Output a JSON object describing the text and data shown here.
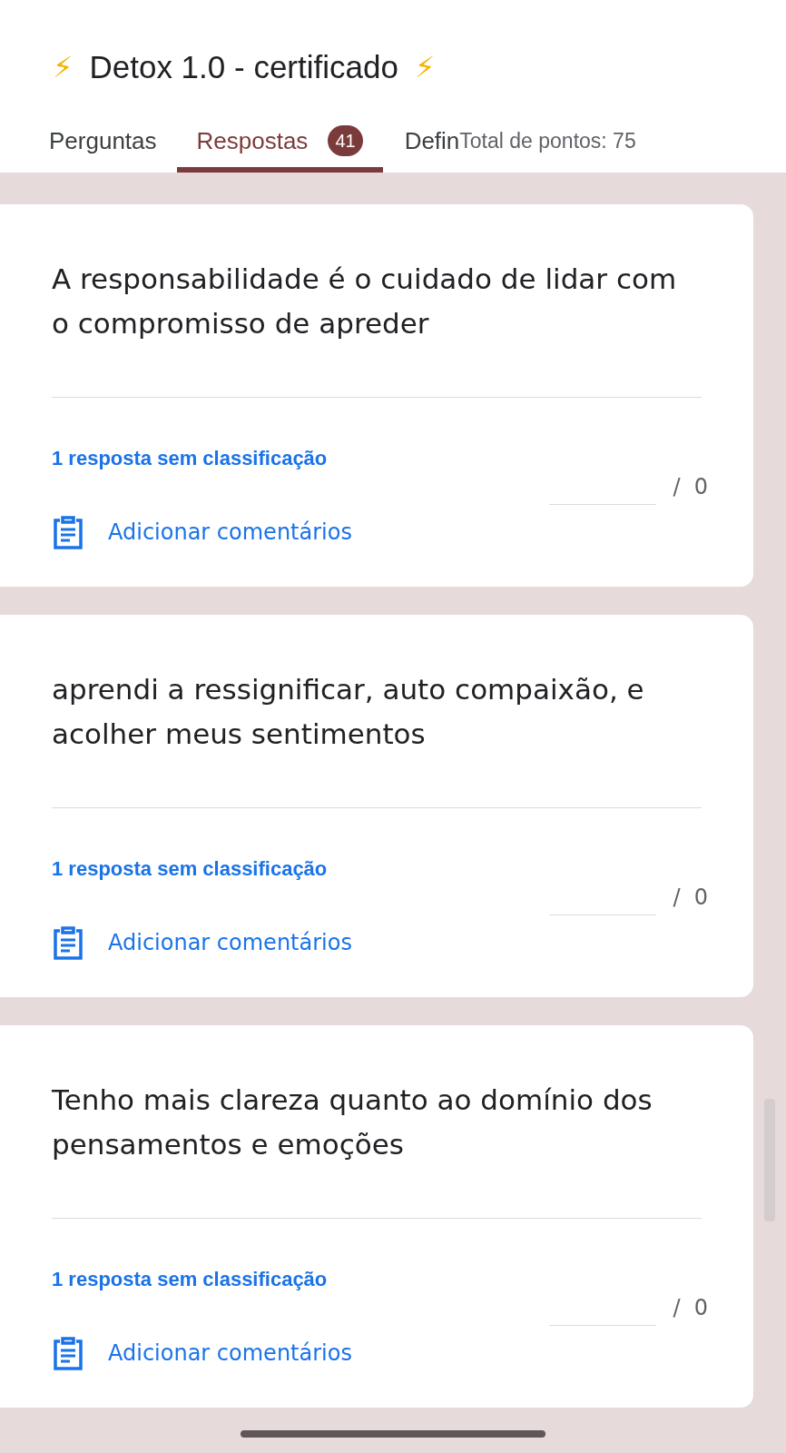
{
  "title": {
    "icon_left": "⚡",
    "text": "Detox 1.0 - certificado",
    "icon_right": "⚡"
  },
  "tabs": [
    {
      "label": "Perguntas",
      "selected": false
    },
    {
      "label": "Respostas",
      "selected": true,
      "badge": "41"
    },
    {
      "label": "Defin",
      "selected": false
    }
  ],
  "total_points": "Total de pontos: 75",
  "cards": [
    {
      "answer": "A responsabilidade é o cuidado de lidar com o compromisso de apreder",
      "status": "1 resposta sem classificação",
      "score_max": "/  0",
      "comment_label": "Adicionar comentários"
    },
    {
      "answer": "aprendi a ressignificar, auto compaixão, e acolher meus sentimentos",
      "status": "1 resposta sem classificação",
      "score_max": "/  0",
      "comment_label": "Adicionar comentários"
    },
    {
      "answer": "Tenho mais clareza quanto ao domínio dos pensamentos e emoções",
      "status": "1 resposta sem classificação",
      "score_max": "/  0",
      "comment_label": "Adicionar comentários"
    }
  ]
}
